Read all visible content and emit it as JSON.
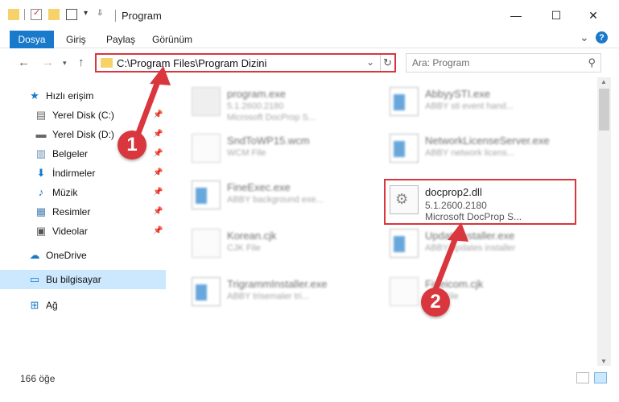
{
  "window": {
    "title": "Program",
    "minimize": "—",
    "maximize": "☐",
    "close": "✕"
  },
  "ribbon": {
    "tabs": [
      "Dosya",
      "Giriş",
      "Paylaş",
      "Görünüm"
    ],
    "help": "?",
    "expand": "⌄"
  },
  "nav": {
    "address": "C:\\Program Files\\Program Dizini",
    "search_placeholder": "Ara: Program"
  },
  "sidebar": {
    "items": [
      {
        "label": "Hızlı erişim",
        "icon": "star-icon",
        "glyph": "★",
        "pinned": false
      },
      {
        "label": "Yerel Disk (C:)",
        "icon": "drive-c-icon",
        "glyph": "▤",
        "pinned": true
      },
      {
        "label": "Yerel Disk (D:)",
        "icon": "drive-d-icon",
        "glyph": "▬",
        "pinned": true
      },
      {
        "label": "Belgeler",
        "icon": "documents-icon",
        "glyph": "▥",
        "pinned": true
      },
      {
        "label": "İndirmeler",
        "icon": "downloads-icon",
        "glyph": "⬇",
        "pinned": true
      },
      {
        "label": "Müzik",
        "icon": "music-icon",
        "glyph": "♪",
        "pinned": true
      },
      {
        "label": "Resimler",
        "icon": "pictures-icon",
        "glyph": "▦",
        "pinned": true
      },
      {
        "label": "Videolar",
        "icon": "videos-icon",
        "glyph": "▣",
        "pinned": true
      },
      {
        "label": "OneDrive",
        "icon": "onedrive-icon",
        "glyph": "☁",
        "pinned": false
      },
      {
        "label": "Bu bilgisayar",
        "icon": "this-pc-icon",
        "glyph": "▭",
        "pinned": false
      },
      {
        "label": "Ağ",
        "icon": "network-icon",
        "glyph": "⊞",
        "pinned": false
      }
    ]
  },
  "files": [
    {
      "name": "program.exe",
      "line1": "5.1.2600.2180",
      "line2": "Microsoft DocProp S...",
      "icon": "exe-icon"
    },
    {
      "name": "AbbyySTI.exe",
      "line1": "ABBY sti event hand...",
      "line2": "",
      "icon": "window-icon"
    },
    {
      "name": "SndToWP15.wcm",
      "line1": "WCM File",
      "line2": "",
      "icon": "blank-file-icon"
    },
    {
      "name": "NetworkLicenseServer.exe",
      "line1": "ABBY network licens...",
      "line2": "",
      "icon": "window-icon"
    },
    {
      "name": "FineExec.exe",
      "line1": "ABBY background exe...",
      "line2": "",
      "icon": "window-icon"
    },
    {
      "name": "docprop2.dll",
      "line1": "5.1.2600.2180",
      "line2": "Microsoft DocProp S...",
      "icon": "dll-gear-icon"
    },
    {
      "name": "Korean.cjk",
      "line1": "CJK File",
      "line2": "",
      "icon": "blank-file-icon"
    },
    {
      "name": "UpdateInstaller.exe",
      "line1": "ABBY updates installer",
      "line2": "",
      "icon": "window-icon"
    },
    {
      "name": "TrigrammInstaller.exe",
      "line1": "ABBY trisemaler tri...",
      "line2": "",
      "icon": "window-icon"
    },
    {
      "name": "Fineicom.cjk",
      "line1": "CJK File",
      "line2": "",
      "icon": "blank-file-icon"
    }
  ],
  "status": {
    "count": "166 öğe"
  },
  "badges": [
    "1",
    "2"
  ],
  "colors": {
    "accent": "#1979ca",
    "highlight": "#d9363e",
    "selected": "#cce8ff"
  }
}
